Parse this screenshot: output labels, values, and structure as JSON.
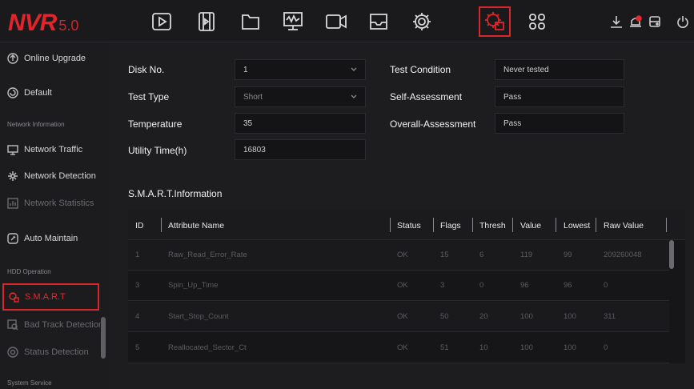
{
  "app": {
    "logo": "NVR",
    "version": "5.0"
  },
  "topnav": {
    "items": [
      {
        "name": "playback-icon"
      },
      {
        "name": "video-clip-icon"
      },
      {
        "name": "folder-icon"
      },
      {
        "name": "monitor-icon"
      },
      {
        "name": "camera-icon"
      },
      {
        "name": "inbox-icon"
      },
      {
        "name": "settings-gear-icon"
      },
      {
        "name": "system-settings-icon",
        "active": true
      },
      {
        "name": "grid-apps-icon"
      }
    ],
    "right": [
      "download-icon",
      "alarm-icon",
      "storage-icon",
      "power-icon"
    ]
  },
  "sidebar": {
    "items": [
      {
        "label": "Online Upgrade",
        "icon": "upgrade-icon"
      },
      {
        "label": "Default",
        "icon": "default-icon"
      },
      {
        "section": "Network Information"
      },
      {
        "label": "Network Traffic",
        "icon": "monitor-icon"
      },
      {
        "label": "Network Detection",
        "icon": "network-icon"
      },
      {
        "label": "Network Statistics",
        "icon": "statistics-icon",
        "dim": true
      },
      {
        "label": "Auto Maintain",
        "icon": "maintain-icon"
      },
      {
        "section": "HDD Operation"
      },
      {
        "label": "S.M.A.R.T",
        "icon": "smart-icon",
        "active": true
      },
      {
        "label": "Bad Track Detection",
        "icon": "bad-track-icon",
        "dim": true
      },
      {
        "label": "Status Detection",
        "icon": "status-icon",
        "dim": true
      },
      {
        "section": "System Service"
      }
    ]
  },
  "form": {
    "disk_no_label": "Disk No.",
    "disk_no_value": "1",
    "test_type_label": "Test Type",
    "test_type_value": "Short",
    "temperature_label": "Temperature",
    "temperature_value": "35",
    "utility_time_label": "Utility Time(h)",
    "utility_time_value": "16803",
    "test_condition_label": "Test Condition",
    "test_condition_value": "Never tested",
    "self_assessment_label": "Self-Assessment",
    "self_assessment_value": "Pass",
    "overall_assessment_label": "Overall-Assessment",
    "overall_assessment_value": "Pass"
  },
  "smart": {
    "title": "S.M.A.R.T.Information",
    "columns": [
      "ID",
      "Attribute Name",
      "Status",
      "Flags",
      "Thresh",
      "Value",
      "Lowest",
      "Raw Value"
    ],
    "rows": [
      [
        "1",
        "Raw_Read_Error_Rate",
        "OK",
        "15",
        "6",
        "119",
        "99",
        "209260048"
      ],
      [
        "3",
        "Spin_Up_Time",
        "OK",
        "3",
        "0",
        "96",
        "96",
        "0"
      ],
      [
        "4",
        "Start_Stop_Count",
        "OK",
        "50",
        "20",
        "100",
        "100",
        "311"
      ],
      [
        "5",
        "Reallocated_Sector_Ct",
        "OK",
        "51",
        "10",
        "100",
        "100",
        "0"
      ]
    ]
  },
  "colors": {
    "accent": "#d8262b",
    "background": "#1d1d20"
  }
}
